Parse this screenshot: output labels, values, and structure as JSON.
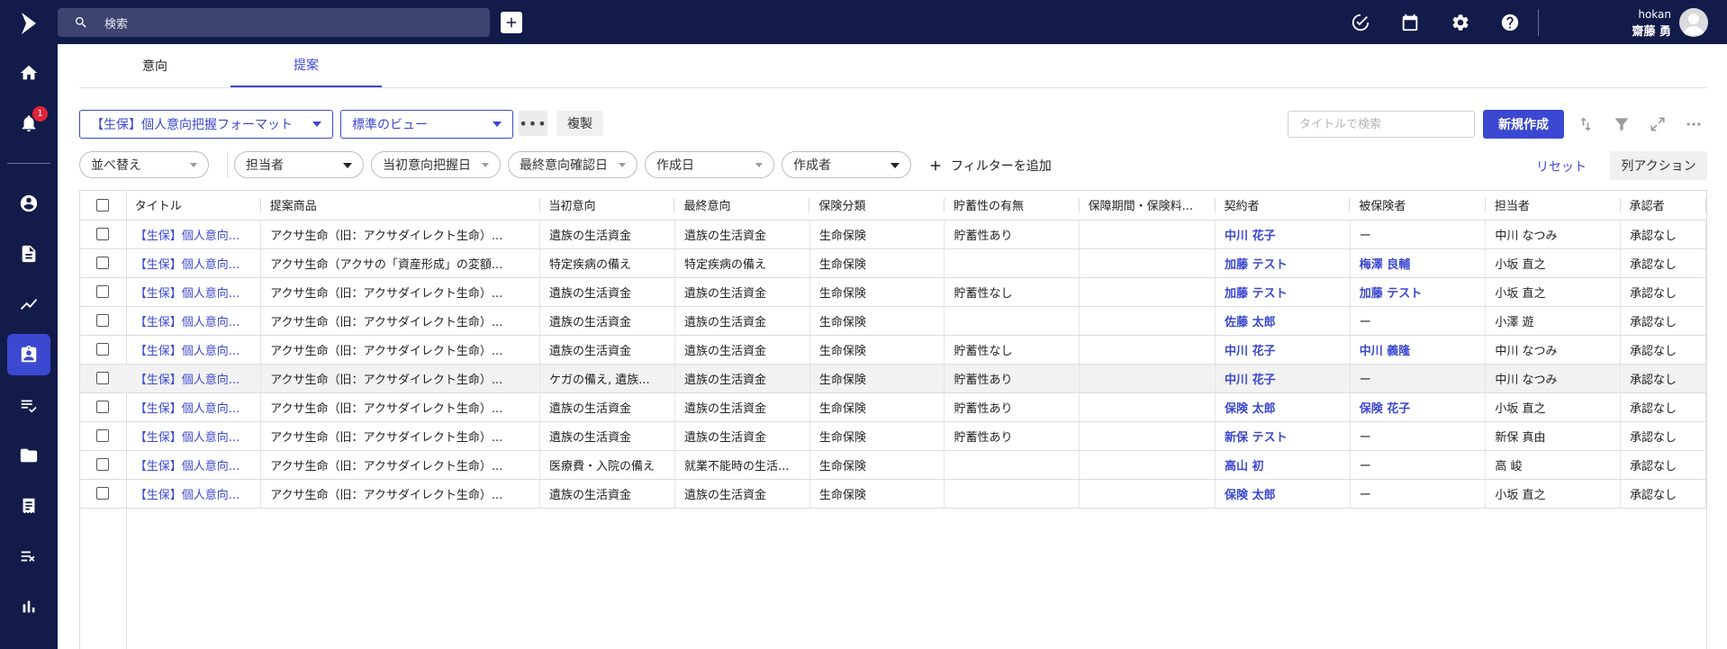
{
  "sidebar": {
    "notification_count": "1",
    "items": [
      "home-icon",
      "bell-icon",
      "account-icon",
      "document-icon",
      "trend-icon",
      "clipboard-icon",
      "checklist-icon",
      "folder-icon",
      "receipt-icon",
      "task-icon",
      "bar-chart-icon"
    ]
  },
  "topbar": {
    "search_placeholder": "検索",
    "user_company": "hokan",
    "user_name": "齋藤 勇"
  },
  "tabs": [
    {
      "label": "意向"
    },
    {
      "label": "提案"
    }
  ],
  "toolbar": {
    "format_select": "【生保】個人意向把握フォーマット",
    "view_select": "標準のビュー",
    "more_label": "•••",
    "copy_label": "複製",
    "title_search_placeholder": "タイトルで検索",
    "new_label": "新規作成"
  },
  "filters": {
    "sort": "並べ替え",
    "assignee": "担当者",
    "initial_date": "当初意向把握日",
    "final_date": "最終意向確認日",
    "created_date": "作成日",
    "creator": "作成者",
    "add_filter": "フィルターを追加",
    "reset": "リセット",
    "column_action": "列アクション"
  },
  "table": {
    "columns": [
      "タイトル",
      "提案商品",
      "当初意向",
      "最終意向",
      "保険分類",
      "貯蓄性の有無",
      "保障期間・保険料...",
      "契約者",
      "被保険者",
      "担当者",
      "承認者"
    ],
    "rows": [
      [
        "【生保】個人意向...",
        "アクサ生命（旧：アクサダイレクト生命）...",
        "遺族の生活資金",
        "遺族の生活資金",
        "生命保険",
        "貯蓄性あり",
        "",
        "中川 花子",
        "ー",
        "中川 なつみ",
        "承認なし"
      ],
      [
        "【生保】個人意向...",
        "アクサ生命（アクサの「資産形成」の変額...",
        "特定疾病の備え",
        "特定疾病の備え",
        "生命保険",
        "",
        "",
        "加藤 テスト",
        "梅澤 良輔",
        "小坂 直之",
        "承認なし"
      ],
      [
        "【生保】個人意向...",
        "アクサ生命（旧：アクサダイレクト生命）...",
        "遺族の生活資金",
        "遺族の生活資金",
        "生命保険",
        "貯蓄性なし",
        "",
        "加藤 テスト",
        "加藤 テスト",
        "小坂 直之",
        "承認なし"
      ],
      [
        "【生保】個人意向...",
        "アクサ生命（旧：アクサダイレクト生命）...",
        "遺族の生活資金",
        "遺族の生活資金",
        "生命保険",
        "",
        "",
        "佐藤 太郎",
        "ー",
        "小澤 遊",
        "承認なし"
      ],
      [
        "【生保】個人意向...",
        "アクサ生命（旧：アクサダイレクト生命）...",
        "遺族の生活資金",
        "遺族の生活資金",
        "生命保険",
        "貯蓄性なし",
        "",
        "中川 花子",
        "中川 義隆",
        "中川 なつみ",
        "承認なし"
      ],
      [
        "【生保】個人意向...",
        "アクサ生命（旧：アクサダイレクト生命）...",
        "ケガの備え, 遺族...",
        "遺族の生活資金",
        "生命保険",
        "貯蓄性あり",
        "",
        "中川 花子",
        "ー",
        "中川 なつみ",
        "承認なし"
      ],
      [
        "【生保】個人意向...",
        "アクサ生命（旧：アクサダイレクト生命）...",
        "遺族の生活資金",
        "遺族の生活資金",
        "生命保険",
        "貯蓄性あり",
        "",
        "保険 太郎",
        "保険 花子",
        "小坂 直之",
        "承認なし"
      ],
      [
        "【生保】個人意向...",
        "アクサ生命（旧：アクサダイレクト生命）...",
        "遺族の生活資金",
        "遺族の生活資金",
        "生命保険",
        "貯蓄性あり",
        "",
        "新保 テスト",
        "ー",
        "新保 真由",
        "承認なし"
      ],
      [
        "【生保】個人意向...",
        "アクサ生命（旧：アクサダイレクト生命）...",
        "医療費・入院の備え",
        "就業不能時の生活...",
        "生命保険",
        "",
        "",
        "高山 初",
        "ー",
        "高 峻",
        "承認なし"
      ],
      [
        "【生保】個人意向...",
        "アクサ生命（旧：アクサダイレクト生命）...",
        "遺族の生活資金",
        "遺族の生活資金",
        "生命保険",
        "",
        "",
        "保険 太郎",
        "ー",
        "小坂 直之",
        "承認なし"
      ]
    ],
    "highlighted_row": 5
  },
  "colors": {
    "sidebar_bg": "#121b4a",
    "accent": "#3b48d1",
    "badge": "#e0243a"
  }
}
